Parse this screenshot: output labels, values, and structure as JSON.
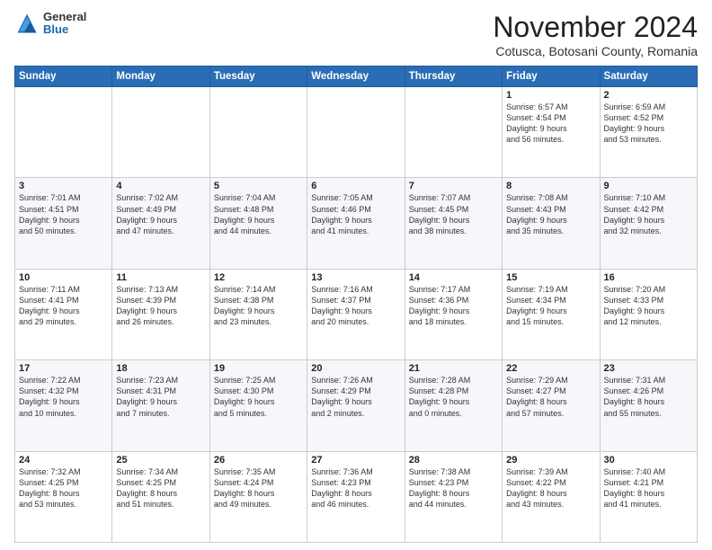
{
  "header": {
    "logo": {
      "general": "General",
      "blue": "Blue"
    },
    "title": "November 2024",
    "location": "Cotusca, Botosani County, Romania"
  },
  "weekdays": [
    "Sunday",
    "Monday",
    "Tuesday",
    "Wednesday",
    "Thursday",
    "Friday",
    "Saturday"
  ],
  "weeks": [
    [
      {
        "day": "",
        "info": ""
      },
      {
        "day": "",
        "info": ""
      },
      {
        "day": "",
        "info": ""
      },
      {
        "day": "",
        "info": ""
      },
      {
        "day": "",
        "info": ""
      },
      {
        "day": "1",
        "info": "Sunrise: 6:57 AM\nSunset: 4:54 PM\nDaylight: 9 hours\nand 56 minutes."
      },
      {
        "day": "2",
        "info": "Sunrise: 6:59 AM\nSunset: 4:52 PM\nDaylight: 9 hours\nand 53 minutes."
      }
    ],
    [
      {
        "day": "3",
        "info": "Sunrise: 7:01 AM\nSunset: 4:51 PM\nDaylight: 9 hours\nand 50 minutes."
      },
      {
        "day": "4",
        "info": "Sunrise: 7:02 AM\nSunset: 4:49 PM\nDaylight: 9 hours\nand 47 minutes."
      },
      {
        "day": "5",
        "info": "Sunrise: 7:04 AM\nSunset: 4:48 PM\nDaylight: 9 hours\nand 44 minutes."
      },
      {
        "day": "6",
        "info": "Sunrise: 7:05 AM\nSunset: 4:46 PM\nDaylight: 9 hours\nand 41 minutes."
      },
      {
        "day": "7",
        "info": "Sunrise: 7:07 AM\nSunset: 4:45 PM\nDaylight: 9 hours\nand 38 minutes."
      },
      {
        "day": "8",
        "info": "Sunrise: 7:08 AM\nSunset: 4:43 PM\nDaylight: 9 hours\nand 35 minutes."
      },
      {
        "day": "9",
        "info": "Sunrise: 7:10 AM\nSunset: 4:42 PM\nDaylight: 9 hours\nand 32 minutes."
      }
    ],
    [
      {
        "day": "10",
        "info": "Sunrise: 7:11 AM\nSunset: 4:41 PM\nDaylight: 9 hours\nand 29 minutes."
      },
      {
        "day": "11",
        "info": "Sunrise: 7:13 AM\nSunset: 4:39 PM\nDaylight: 9 hours\nand 26 minutes."
      },
      {
        "day": "12",
        "info": "Sunrise: 7:14 AM\nSunset: 4:38 PM\nDaylight: 9 hours\nand 23 minutes."
      },
      {
        "day": "13",
        "info": "Sunrise: 7:16 AM\nSunset: 4:37 PM\nDaylight: 9 hours\nand 20 minutes."
      },
      {
        "day": "14",
        "info": "Sunrise: 7:17 AM\nSunset: 4:36 PM\nDaylight: 9 hours\nand 18 minutes."
      },
      {
        "day": "15",
        "info": "Sunrise: 7:19 AM\nSunset: 4:34 PM\nDaylight: 9 hours\nand 15 minutes."
      },
      {
        "day": "16",
        "info": "Sunrise: 7:20 AM\nSunset: 4:33 PM\nDaylight: 9 hours\nand 12 minutes."
      }
    ],
    [
      {
        "day": "17",
        "info": "Sunrise: 7:22 AM\nSunset: 4:32 PM\nDaylight: 9 hours\nand 10 minutes."
      },
      {
        "day": "18",
        "info": "Sunrise: 7:23 AM\nSunset: 4:31 PM\nDaylight: 9 hours\nand 7 minutes."
      },
      {
        "day": "19",
        "info": "Sunrise: 7:25 AM\nSunset: 4:30 PM\nDaylight: 9 hours\nand 5 minutes."
      },
      {
        "day": "20",
        "info": "Sunrise: 7:26 AM\nSunset: 4:29 PM\nDaylight: 9 hours\nand 2 minutes."
      },
      {
        "day": "21",
        "info": "Sunrise: 7:28 AM\nSunset: 4:28 PM\nDaylight: 9 hours\nand 0 minutes."
      },
      {
        "day": "22",
        "info": "Sunrise: 7:29 AM\nSunset: 4:27 PM\nDaylight: 8 hours\nand 57 minutes."
      },
      {
        "day": "23",
        "info": "Sunrise: 7:31 AM\nSunset: 4:26 PM\nDaylight: 8 hours\nand 55 minutes."
      }
    ],
    [
      {
        "day": "24",
        "info": "Sunrise: 7:32 AM\nSunset: 4:25 PM\nDaylight: 8 hours\nand 53 minutes."
      },
      {
        "day": "25",
        "info": "Sunrise: 7:34 AM\nSunset: 4:25 PM\nDaylight: 8 hours\nand 51 minutes."
      },
      {
        "day": "26",
        "info": "Sunrise: 7:35 AM\nSunset: 4:24 PM\nDaylight: 8 hours\nand 49 minutes."
      },
      {
        "day": "27",
        "info": "Sunrise: 7:36 AM\nSunset: 4:23 PM\nDaylight: 8 hours\nand 46 minutes."
      },
      {
        "day": "28",
        "info": "Sunrise: 7:38 AM\nSunset: 4:23 PM\nDaylight: 8 hours\nand 44 minutes."
      },
      {
        "day": "29",
        "info": "Sunrise: 7:39 AM\nSunset: 4:22 PM\nDaylight: 8 hours\nand 43 minutes."
      },
      {
        "day": "30",
        "info": "Sunrise: 7:40 AM\nSunset: 4:21 PM\nDaylight: 8 hours\nand 41 minutes."
      }
    ]
  ]
}
